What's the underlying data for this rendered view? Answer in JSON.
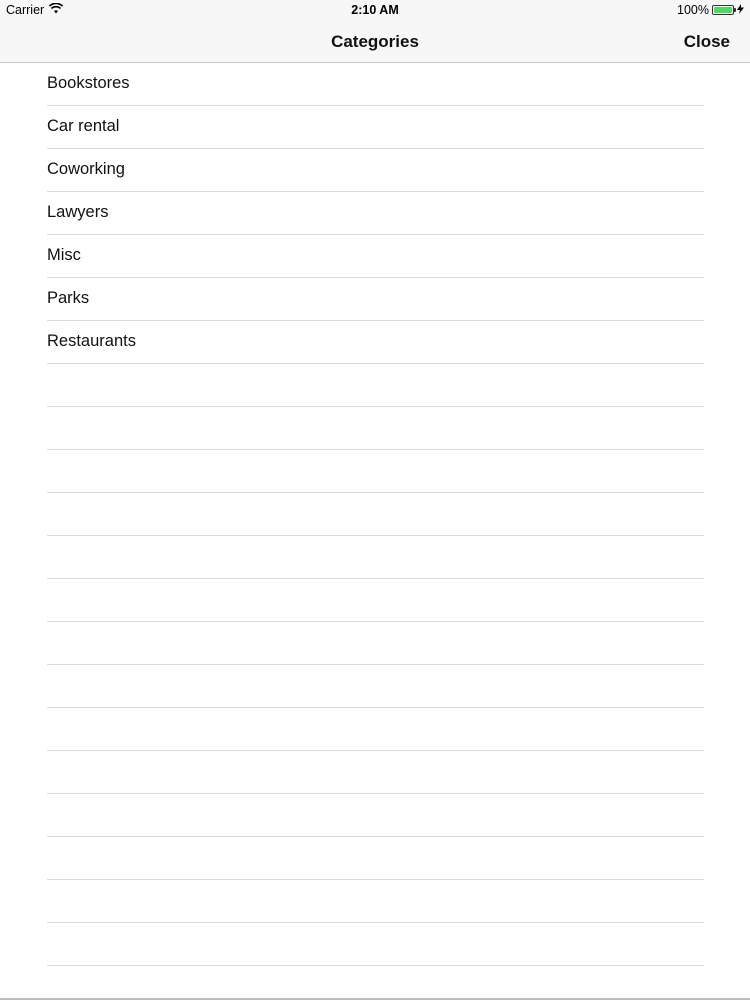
{
  "status_bar": {
    "carrier": "Carrier",
    "time": "2:10 AM",
    "battery": "100%",
    "icons": [
      "wifi-icon",
      "battery-icon",
      "charging-bolt-icon"
    ],
    "battery_color": "#4cd964"
  },
  "nav": {
    "title": "Categories",
    "close_label": "Close"
  },
  "categories": [
    {
      "label": "Bookstores"
    },
    {
      "label": "Car rental"
    },
    {
      "label": "Coworking"
    },
    {
      "label": "Lawyers"
    },
    {
      "label": "Misc"
    },
    {
      "label": "Parks"
    },
    {
      "label": "Restaurants"
    }
  ],
  "empty_rows": 14
}
